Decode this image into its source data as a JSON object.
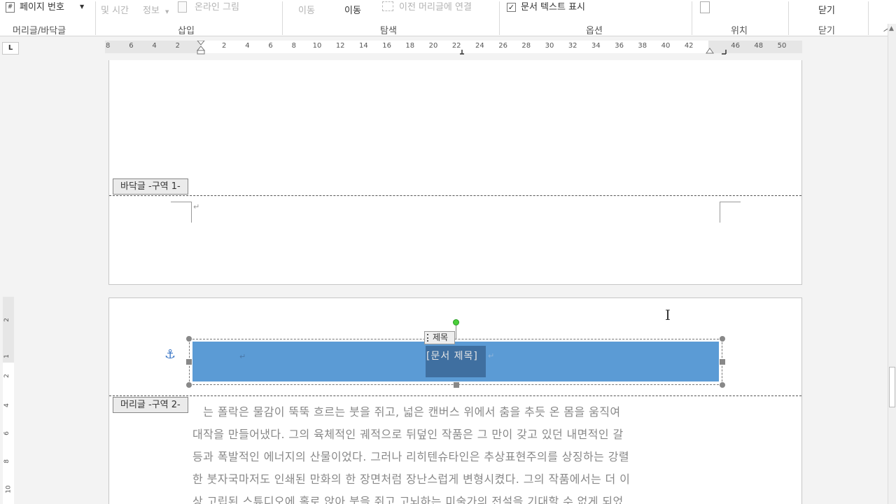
{
  "ribbon": {
    "page_number_button": "페이지 번호",
    "date_time_button": "및 시간",
    "doc_info_button": "정보",
    "online_pictures_button": "온라인 그림",
    "goto_label_a": "이동",
    "goto_label_b": "이동",
    "link_to_previous": "이전 머리글에 연결",
    "show_document_text": "문서 텍스트 표시",
    "close_button": "닫기",
    "groups": {
      "header_footer": "머리글/바닥글",
      "insert": "삽입",
      "navigation": "탐색",
      "options": "옵션",
      "position": "위치",
      "close": "닫기"
    }
  },
  "ruler": {
    "corner": "L",
    "labels": [
      "8",
      "6",
      "4",
      "2",
      "2",
      "4",
      "6",
      "8",
      "10",
      "12",
      "14",
      "16",
      "18",
      "20",
      "22",
      "24",
      "26",
      "28",
      "30",
      "32",
      "34",
      "36",
      "38",
      "40",
      "42",
      "46",
      "48",
      "50"
    ],
    "vertical_labels": [
      "2",
      "1",
      "2",
      "4",
      "6",
      "8",
      "10"
    ]
  },
  "document": {
    "footer_tag": "바닥글 -구역 1-",
    "header_tag": "머리글 -구역 2-",
    "content_control_tab": "제목",
    "title_placeholder": "[문서 제목]",
    "body_lines": [
      "그는 폴락은 물감이 뚝뚝 흐르는 붓을 쥐고, 넓은 캔버스 위에서 춤을 추듯 온 몸을 움직여",
      "대작을 만들어냈다. 그의 육체적인 궤적으로 뒤덮인 작품은 그 만이 갖고 있던 내면적인 갈",
      "등과 폭발적인 에너지의 산물이었다. 그러나 리히텐슈타인은 추상표현주의를 상징하는 강렬",
      "한 붓자국마저도 인쇄된 만화의 한 장면처럼 장난스럽게 변형시켰다. 그의 작품에서는 더 이",
      "상 고립된 스튜디오에 홀로 앉아 붓을 쥐고 고뇌하는 미술가의 전설을 기대할 수 없게 되었"
    ]
  },
  "colors": {
    "title_band": "#5b9bd5",
    "title_field": "#3f6fa0",
    "rotate_handle": "#4ccf3b"
  }
}
